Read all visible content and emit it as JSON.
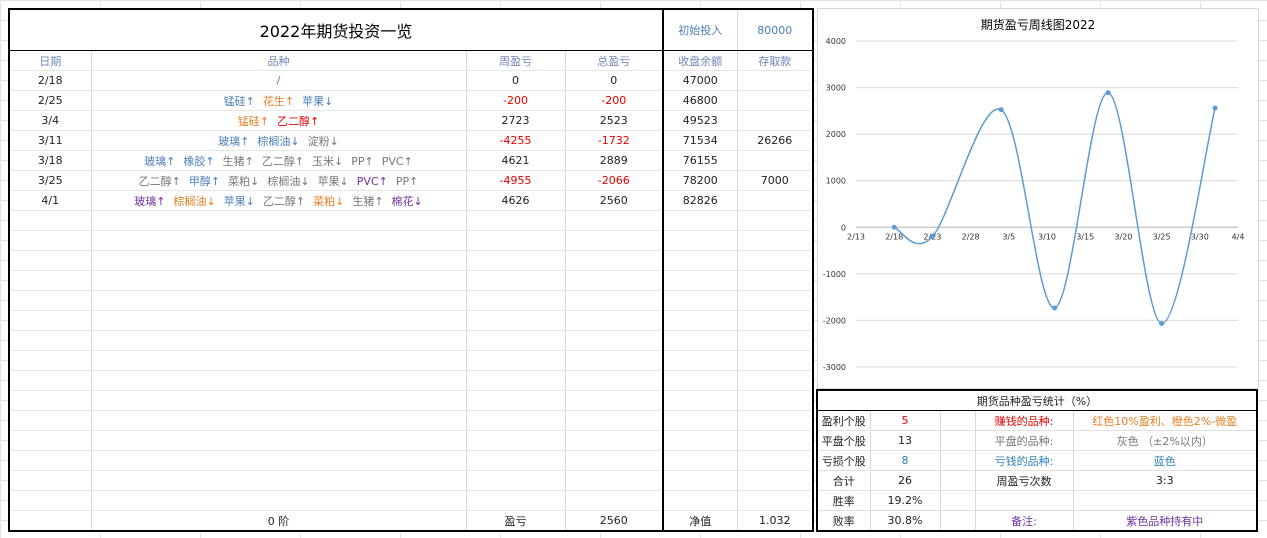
{
  "main": {
    "title": "2022年期货投资一览",
    "initial_label": "初始投入",
    "initial_value": "80000",
    "headers": {
      "date": "日期",
      "variety": "品种",
      "weekly": "周盈亏",
      "total": "总盈亏",
      "balance": "收盘余额",
      "deposit": "存取款"
    },
    "rows": [
      {
        "date": "2/18",
        "items": [
          {
            "t": "/",
            "c": "blue"
          }
        ],
        "weekly": "0",
        "weekly_color": "black",
        "total": "0",
        "total_color": "black",
        "balance": "47000",
        "deposit": ""
      },
      {
        "date": "2/25",
        "items": [
          {
            "t": "锰硅↑",
            "c": "blue"
          },
          {
            "t": "花生↑",
            "c": "orange"
          },
          {
            "t": "苹果↓",
            "c": "blue"
          }
        ],
        "weekly": "-200",
        "weekly_color": "red",
        "total": "-200",
        "total_color": "red",
        "balance": "46800",
        "deposit": ""
      },
      {
        "date": "3/4",
        "items": [
          {
            "t": "锰硅↑",
            "c": "orange"
          },
          {
            "t": "乙二醇↑",
            "c": "red"
          }
        ],
        "weekly": "2723",
        "weekly_color": "black",
        "total": "2523",
        "total_color": "black",
        "balance": "49523",
        "deposit": ""
      },
      {
        "date": "3/11",
        "items": [
          {
            "t": "玻璃↑",
            "c": "blue"
          },
          {
            "t": "棕榈油↓",
            "c": "blue"
          },
          {
            "t": "淀粉↓",
            "c": "gray"
          }
        ],
        "weekly": "-4255",
        "weekly_color": "red",
        "total": "-1732",
        "total_color": "red",
        "balance": "71534",
        "deposit": "26266"
      },
      {
        "date": "3/18",
        "items": [
          {
            "t": "玻璃↑",
            "c": "blue"
          },
          {
            "t": "橡胶↑",
            "c": "blue"
          },
          {
            "t": "生猪↑",
            "c": "gray"
          },
          {
            "t": "乙二醇↑",
            "c": "gray"
          },
          {
            "t": "玉米↓",
            "c": "gray"
          },
          {
            "t": "PP↑",
            "c": "gray"
          },
          {
            "t": "PVC↑",
            "c": "gray"
          }
        ],
        "weekly": "4621",
        "weekly_color": "black",
        "total": "2889",
        "total_color": "black",
        "balance": "76155",
        "deposit": ""
      },
      {
        "date": "3/25",
        "items": [
          {
            "t": "乙二醇↑",
            "c": "gray"
          },
          {
            "t": "甲醇↑",
            "c": "blue"
          },
          {
            "t": "菜粕↓",
            "c": "gray"
          },
          {
            "t": "棕榈油↓",
            "c": "gray"
          },
          {
            "t": "苹果↓",
            "c": "gray"
          },
          {
            "t": "PVC↑",
            "c": "purple"
          },
          {
            "t": "PP↑",
            "c": "gray"
          }
        ],
        "weekly": "-4955",
        "weekly_color": "red",
        "total": "-2066",
        "total_color": "red",
        "balance": "78200",
        "deposit": "7000"
      },
      {
        "date": "4/1",
        "items": [
          {
            "t": "玻璃↑",
            "c": "purple"
          },
          {
            "t": "棕榈油↓",
            "c": "orange"
          },
          {
            "t": "苹果↓",
            "c": "blue"
          },
          {
            "t": "乙二醇↑",
            "c": "gray"
          },
          {
            "t": "菜粕↓",
            "c": "orange"
          },
          {
            "t": "生猪↑",
            "c": "gray"
          },
          {
            "t": "棉花↓",
            "c": "purple"
          }
        ],
        "weekly": "4626",
        "weekly_color": "black",
        "total": "2560",
        "total_color": "black",
        "balance": "82826",
        "deposit": ""
      }
    ],
    "footer": {
      "step": "0 阶",
      "pnl_label": "盈亏",
      "pnl_value": "2560",
      "net_label": "净值",
      "net_value": "1.032"
    }
  },
  "chart_data": {
    "type": "line",
    "title": "期货盈亏周线图2022",
    "x": [
      "2/18",
      "2/23",
      "3/4",
      "3/11",
      "3/18",
      "3/25",
      "4/1"
    ],
    "series": [
      {
        "values": [
          0,
          -200,
          2523,
          -1732,
          2889,
          -2066,
          2560
        ]
      }
    ],
    "x_ticks": [
      "2/13",
      "2/18",
      "2/23",
      "2/28",
      "3/5",
      "3/10",
      "3/15",
      "3/20",
      "3/25",
      "3/30",
      "4/4"
    ],
    "y_ticks": [
      "4000",
      "3000",
      "2000",
      "1000",
      "0",
      "-1000",
      "-2000",
      "-3000"
    ],
    "ylim": [
      -3000,
      4000
    ],
    "grid": true,
    "line_color": "#5b9bd5"
  },
  "stats": {
    "title": "期货品种盈亏统计（%）",
    "rows": [
      {
        "label": "盈利个股",
        "value": "5",
        "value_color": "red",
        "key": "赚钱的品种:",
        "key_color": "red",
        "desc": "红色10%盈利、橙色2%-微盈",
        "desc_color": "orange"
      },
      {
        "label": "平盘个股",
        "value": "13",
        "value_color": "black",
        "key": "平盘的品种:",
        "key_color": "gray",
        "desc": "灰色 （±2%以内）",
        "desc_color": "gray"
      },
      {
        "label": "亏损个股",
        "value": "8",
        "value_color": "blue",
        "key": "亏钱的品种:",
        "key_color": "blue",
        "desc": "蓝色",
        "desc_color": "blue"
      },
      {
        "label": "合计",
        "value": "26",
        "value_color": "black",
        "key": "周盈亏次数",
        "key_color": "black",
        "desc": "3:3",
        "desc_color": "black"
      },
      {
        "label": "胜率",
        "value": "19.2%",
        "value_color": "black",
        "key": "",
        "key_color": "black",
        "desc": "",
        "desc_color": "black"
      },
      {
        "label": "败率",
        "value": "30.8%",
        "value_color": "black",
        "key": "备注:",
        "key_color": "purple",
        "desc": "紫色品种持有中",
        "desc_color": "purple"
      }
    ]
  }
}
